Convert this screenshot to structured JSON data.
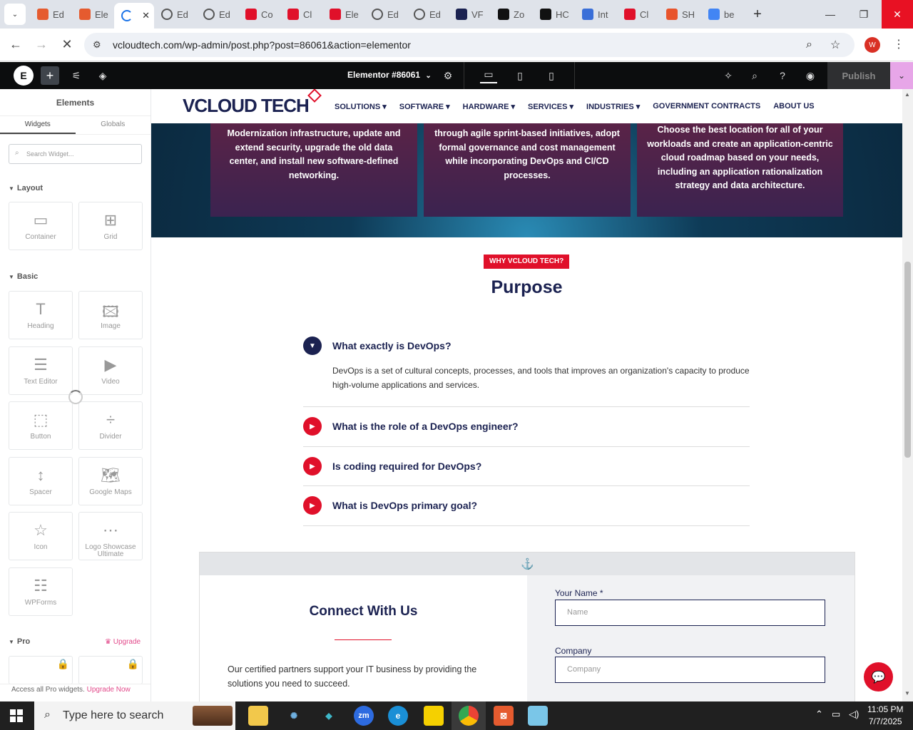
{
  "browser": {
    "tabs": [
      {
        "label": "Ed",
        "icon": "elementor-orange-icon",
        "color": "#e55b2f"
      },
      {
        "label": "Ele",
        "icon": "elementor-orange-icon",
        "color": "#e55b2f"
      },
      {
        "label": "",
        "icon": "loading-icon",
        "color": "#1a73e8",
        "active": true
      },
      {
        "label": "Ed",
        "icon": "globe-icon",
        "color": "#555"
      },
      {
        "label": "Ed",
        "icon": "globe-icon",
        "color": "#555"
      },
      {
        "label": "Co",
        "icon": "diamond-icon",
        "color": "#e0102a"
      },
      {
        "label": "Cl",
        "icon": "diamond-icon",
        "color": "#e0102a"
      },
      {
        "label": "Ele",
        "icon": "diamond-icon",
        "color": "#e0102a"
      },
      {
        "label": "Ed",
        "icon": "globe-icon",
        "color": "#555"
      },
      {
        "label": "Ed",
        "icon": "globe-icon",
        "color": "#555"
      },
      {
        "label": "VF",
        "icon": "vf-icon",
        "color": "#1b2251"
      },
      {
        "label": "Zo",
        "icon": "z-icon",
        "color": "#111"
      },
      {
        "label": "HC",
        "icon": "openai-icon",
        "color": "#111"
      },
      {
        "label": "Int",
        "icon": "swirl-icon",
        "color": "#3a6fd8"
      },
      {
        "label": "Cl",
        "icon": "scribble-icon",
        "color": "#e0102a"
      },
      {
        "label": "SH",
        "icon": "ring-icon",
        "color": "#e8542c"
      },
      {
        "label": "be",
        "icon": "google-icon",
        "color": "#4285f4"
      }
    ],
    "close_tab": "✕",
    "new_tab": "+",
    "url": "vcloudtech.com/wp-admin/post.php?post=86061&action=elementor",
    "profile_initial": "W"
  },
  "editor": {
    "document_title": "Elementor #86061",
    "publish_label": "Publish",
    "panel_title": "Elements",
    "tabs": [
      "Widgets",
      "Globals"
    ],
    "search_placeholder": "Search Widget...",
    "sections": {
      "layout": "Layout",
      "basic": "Basic",
      "pro": "Pro"
    },
    "layout_widgets": [
      "Container",
      "Grid"
    ],
    "basic_widgets": [
      "Heading",
      "Image",
      "Text Editor",
      "Video",
      "Button",
      "Divider",
      "Spacer",
      "Google Maps",
      "Icon",
      "Logo Showcase Ultimate",
      "WPForms"
    ],
    "upgrade_label": "Upgrade",
    "pro_footer_text": "Access all Pro widgets.",
    "pro_footer_link": "Upgrade Now"
  },
  "site": {
    "logo": "VCLOUD TECH",
    "menu": [
      "SOLUTIONS ▾",
      "SOFTWARE ▾",
      "HARDWARE ▾",
      "SERVICES ▾",
      "INDUSTRIES ▾",
      "GOVERNMENT CONTRACTS",
      "ABOUT US"
    ],
    "cards": [
      "Modernization infrastructure, update and extend security, upgrade the old data center, and install new software-defined networking.",
      "through agile sprint-based initiatives, adopt formal governance and cost management while incorporating DevOps and CI/CD processes.",
      "Choose the best location for all of your workloads and create an application-centric cloud roadmap based on your needs, including an application rationalization strategy and data architecture."
    ],
    "badge": "WHY VCLOUD TECH?",
    "heading": "Purpose",
    "faq": [
      {
        "q": "What exactly is DevOps?",
        "open": true
      },
      {
        "q": "What is the role of a DevOps engineer?"
      },
      {
        "q": "Is coding required for DevOps?"
      },
      {
        "q": "What is DevOps primary goal?"
      }
    ],
    "faq_answer": "DevOps is a set of cultural concepts, processes, and tools that improves an organization's capacity to produce high-volume applications and services.",
    "connect": {
      "title": "Connect With Us",
      "text": "Our certified partners support your IT business by providing the solutions you need to succeed.",
      "name_label": "Your Name *",
      "name_placeholder": "Name",
      "company_label": "Company",
      "company_placeholder": "Company"
    }
  },
  "taskbar": {
    "search_placeholder": "Type here to search",
    "time": "11:05 PM",
    "date": "7/7/2025"
  },
  "colors": {
    "brand_navy": "#1b2251",
    "brand_red": "#e0102a",
    "elementor_bar": "#0c0d0e"
  }
}
